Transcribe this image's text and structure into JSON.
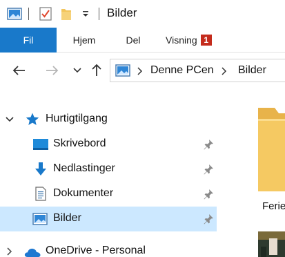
{
  "window": {
    "title": "Bilder"
  },
  "ribbon": {
    "tabs": [
      {
        "label": "Fil",
        "active": true
      },
      {
        "label": "Hjem"
      },
      {
        "label": "Del"
      },
      {
        "label": "Visning",
        "badge": "1"
      }
    ]
  },
  "address": {
    "crumbs": [
      "Denne PCen",
      "Bilder"
    ]
  },
  "nav": {
    "quick_access": "Hurtigtilgang",
    "items": [
      {
        "label": "Skrivebord",
        "icon": "desktop-icon",
        "pinned": true
      },
      {
        "label": "Nedlastinger",
        "icon": "download-icon",
        "pinned": true
      },
      {
        "label": "Dokumenter",
        "icon": "document-icon",
        "pinned": true
      },
      {
        "label": "Bilder",
        "icon": "pictures-icon",
        "pinned": true,
        "selected": true
      }
    ],
    "onedrive": "OneDrive - Personal"
  },
  "content": {
    "folder_label": "Ferie"
  },
  "colors": {
    "accent": "#1979ca",
    "selection": "#cce8ff",
    "badge": "#c42b1c",
    "folder": "#f2c55c"
  }
}
